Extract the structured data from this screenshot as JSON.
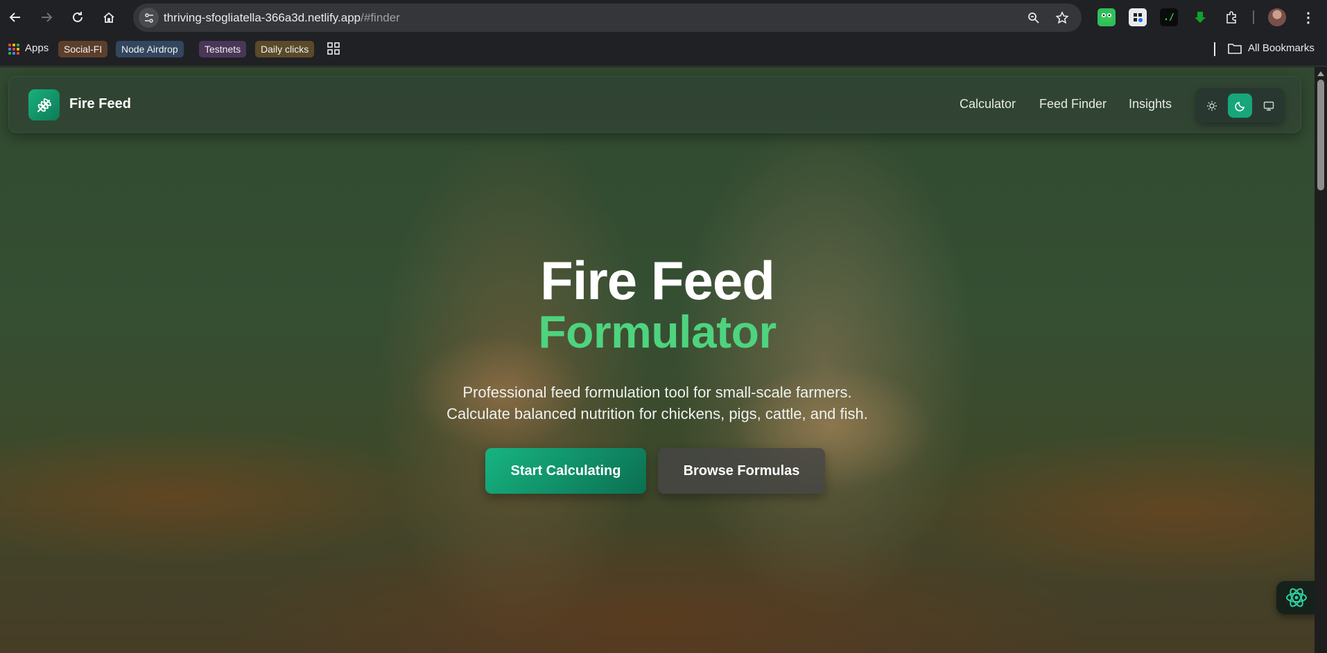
{
  "browser": {
    "url_host": "thriving-sfogliatella-366a3d.netlify.app",
    "url_path": "/#finder",
    "bookmarks_bar": {
      "apps_label": "Apps",
      "items": [
        {
          "label": "Social-FI",
          "color": "#5c3f2b"
        },
        {
          "label": "Node Airdrop",
          "color": "#33465f"
        },
        {
          "label": "Testnets",
          "color": "#4a3658"
        },
        {
          "label": "Daily clicks",
          "color": "#5a4a2a"
        }
      ],
      "all_bookmarks_label": "All Bookmarks"
    }
  },
  "app": {
    "brand": "Fire Feed",
    "nav": {
      "links": [
        "Calculator",
        "Feed Finder",
        "Insights"
      ]
    },
    "theme_options": [
      {
        "name": "light",
        "icon": "sun-icon",
        "active": false
      },
      {
        "name": "dark",
        "icon": "moon-icon",
        "active": true
      },
      {
        "name": "system",
        "icon": "monitor-icon",
        "active": false
      }
    ],
    "hero": {
      "title": "Fire Feed",
      "subtitle": "Formulator",
      "description_line1": "Professional feed formulation tool for small-scale farmers.",
      "description_line2": "Calculate balanced nutrition for chickens, pigs, cattle, and fish.",
      "primary_button": "Start Calculating",
      "secondary_button": "Browse Formulas"
    },
    "colors": {
      "accent": "#17a679",
      "subtitle_green": "#4ed37e"
    }
  }
}
